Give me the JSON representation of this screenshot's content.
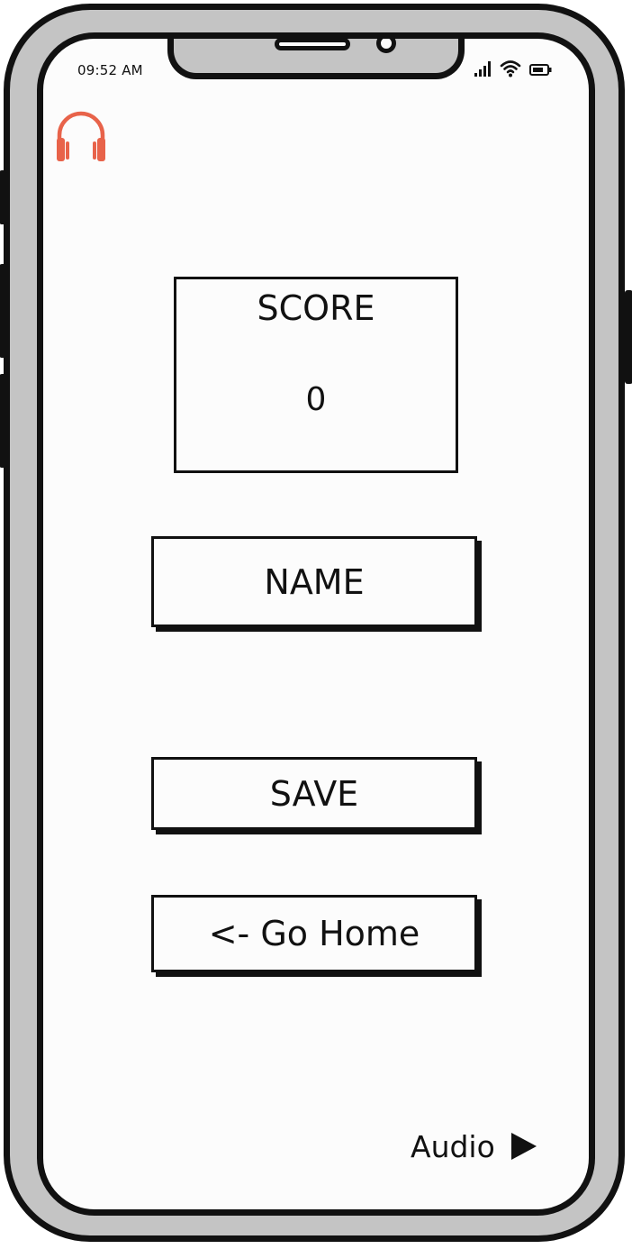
{
  "status_bar": {
    "time": "09:52 AM",
    "icons": [
      "cellular-signal-icon",
      "wifi-icon",
      "battery-icon"
    ]
  },
  "app": {
    "logo_icon": "headphones-icon",
    "accent_color": "#e8634a"
  },
  "score_panel": {
    "label": "SCORE",
    "value": "0"
  },
  "name_field": {
    "label": "NAME"
  },
  "actions": {
    "save_label": "SAVE",
    "home_label": "<- Go Home"
  },
  "audio": {
    "label": "Audio",
    "icon": "play-icon"
  }
}
